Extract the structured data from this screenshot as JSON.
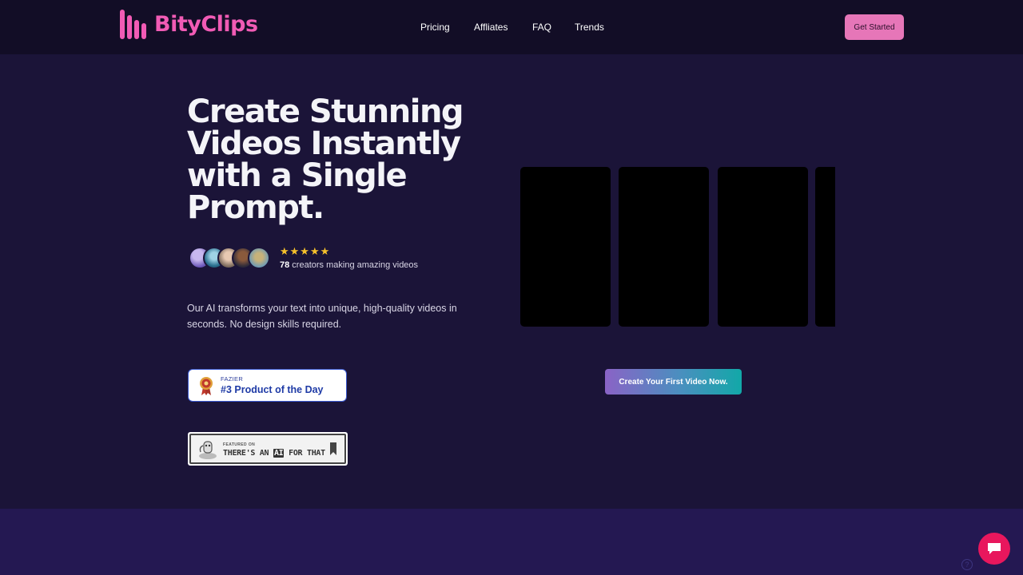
{
  "brand": {
    "name": "BityClips",
    "color": "#f15bb5"
  },
  "nav": {
    "items": [
      {
        "label": "Pricing"
      },
      {
        "label": "Affliates"
      },
      {
        "label": "FAQ"
      },
      {
        "label": "Trends"
      }
    ],
    "cta_label": "Get Started"
  },
  "hero": {
    "headline": "Create Stunning Videos Instantly with a Single Prompt.",
    "rating_stars": "★★★★★",
    "rating_value": 5,
    "creator_count": "78",
    "creator_text": " creators making amazing videos",
    "description": "Our AI transforms your text into unique, high-quality videos in seconds. No design skills required.",
    "primary_cta_label": "Create Your First Video Now."
  },
  "badges": {
    "fazier": {
      "small": "FAZIER",
      "big": "#3 Product of the Day"
    },
    "taaft": {
      "small": "FEATURED ON",
      "big_prefix": "THERE'S AN ",
      "big_ai": "AI",
      "big_suffix": " FOR THAT"
    }
  },
  "icons": {
    "chat": "chat-bubble-icon",
    "medal": "medal-icon",
    "robot": "robot-icon",
    "bookmark": "bookmark-icon"
  },
  "colors": {
    "background": "#1b1438",
    "header": "#120d26",
    "accent": "#f15bb5",
    "star": "#f6c12b",
    "chat_button": "#e8175d"
  }
}
